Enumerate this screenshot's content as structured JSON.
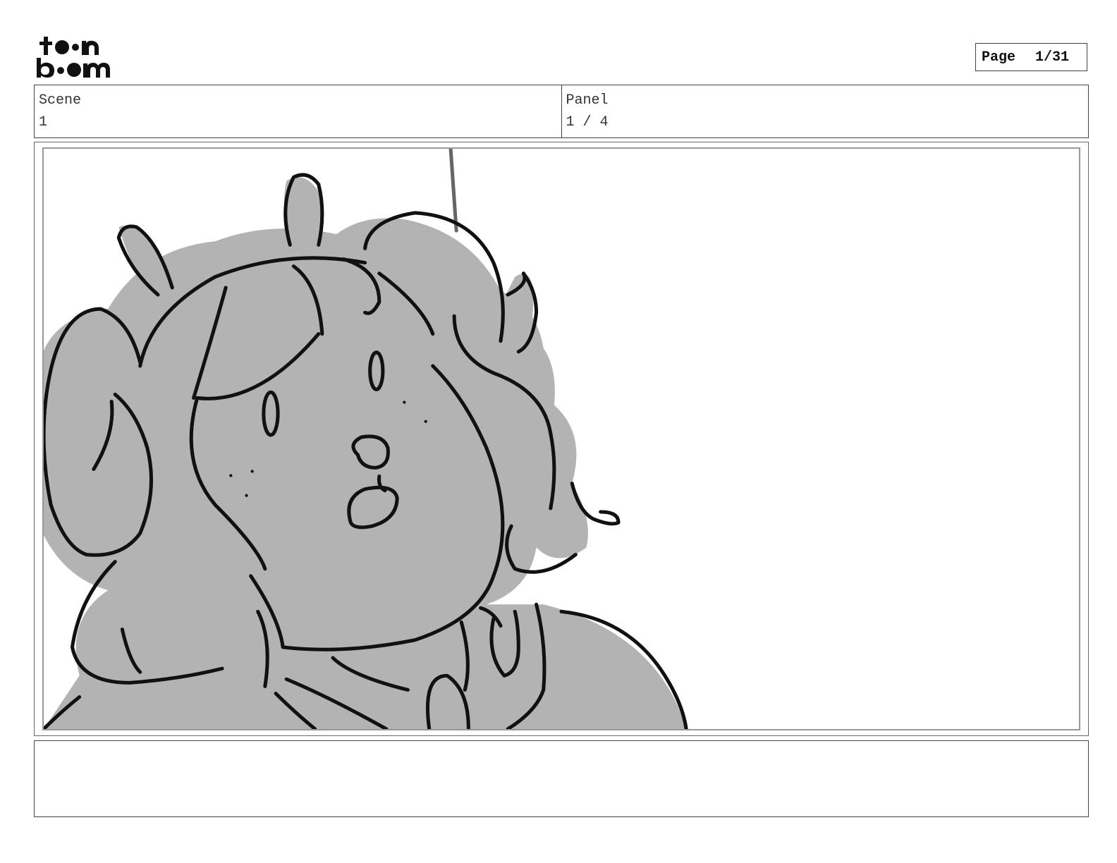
{
  "header": {
    "logo_text_top": "toon",
    "logo_text_bottom": "boom",
    "page_label": "Page",
    "page_value": "1/31"
  },
  "scene": {
    "label": "Scene",
    "value": "1"
  },
  "panel": {
    "label": "Panel",
    "value": "1 / 4"
  },
  "drawing": {
    "subject": "character-sketch-icon",
    "fill_color": "#b3b3b3",
    "line_color": "#111111"
  },
  "notes": {
    "text": ""
  }
}
